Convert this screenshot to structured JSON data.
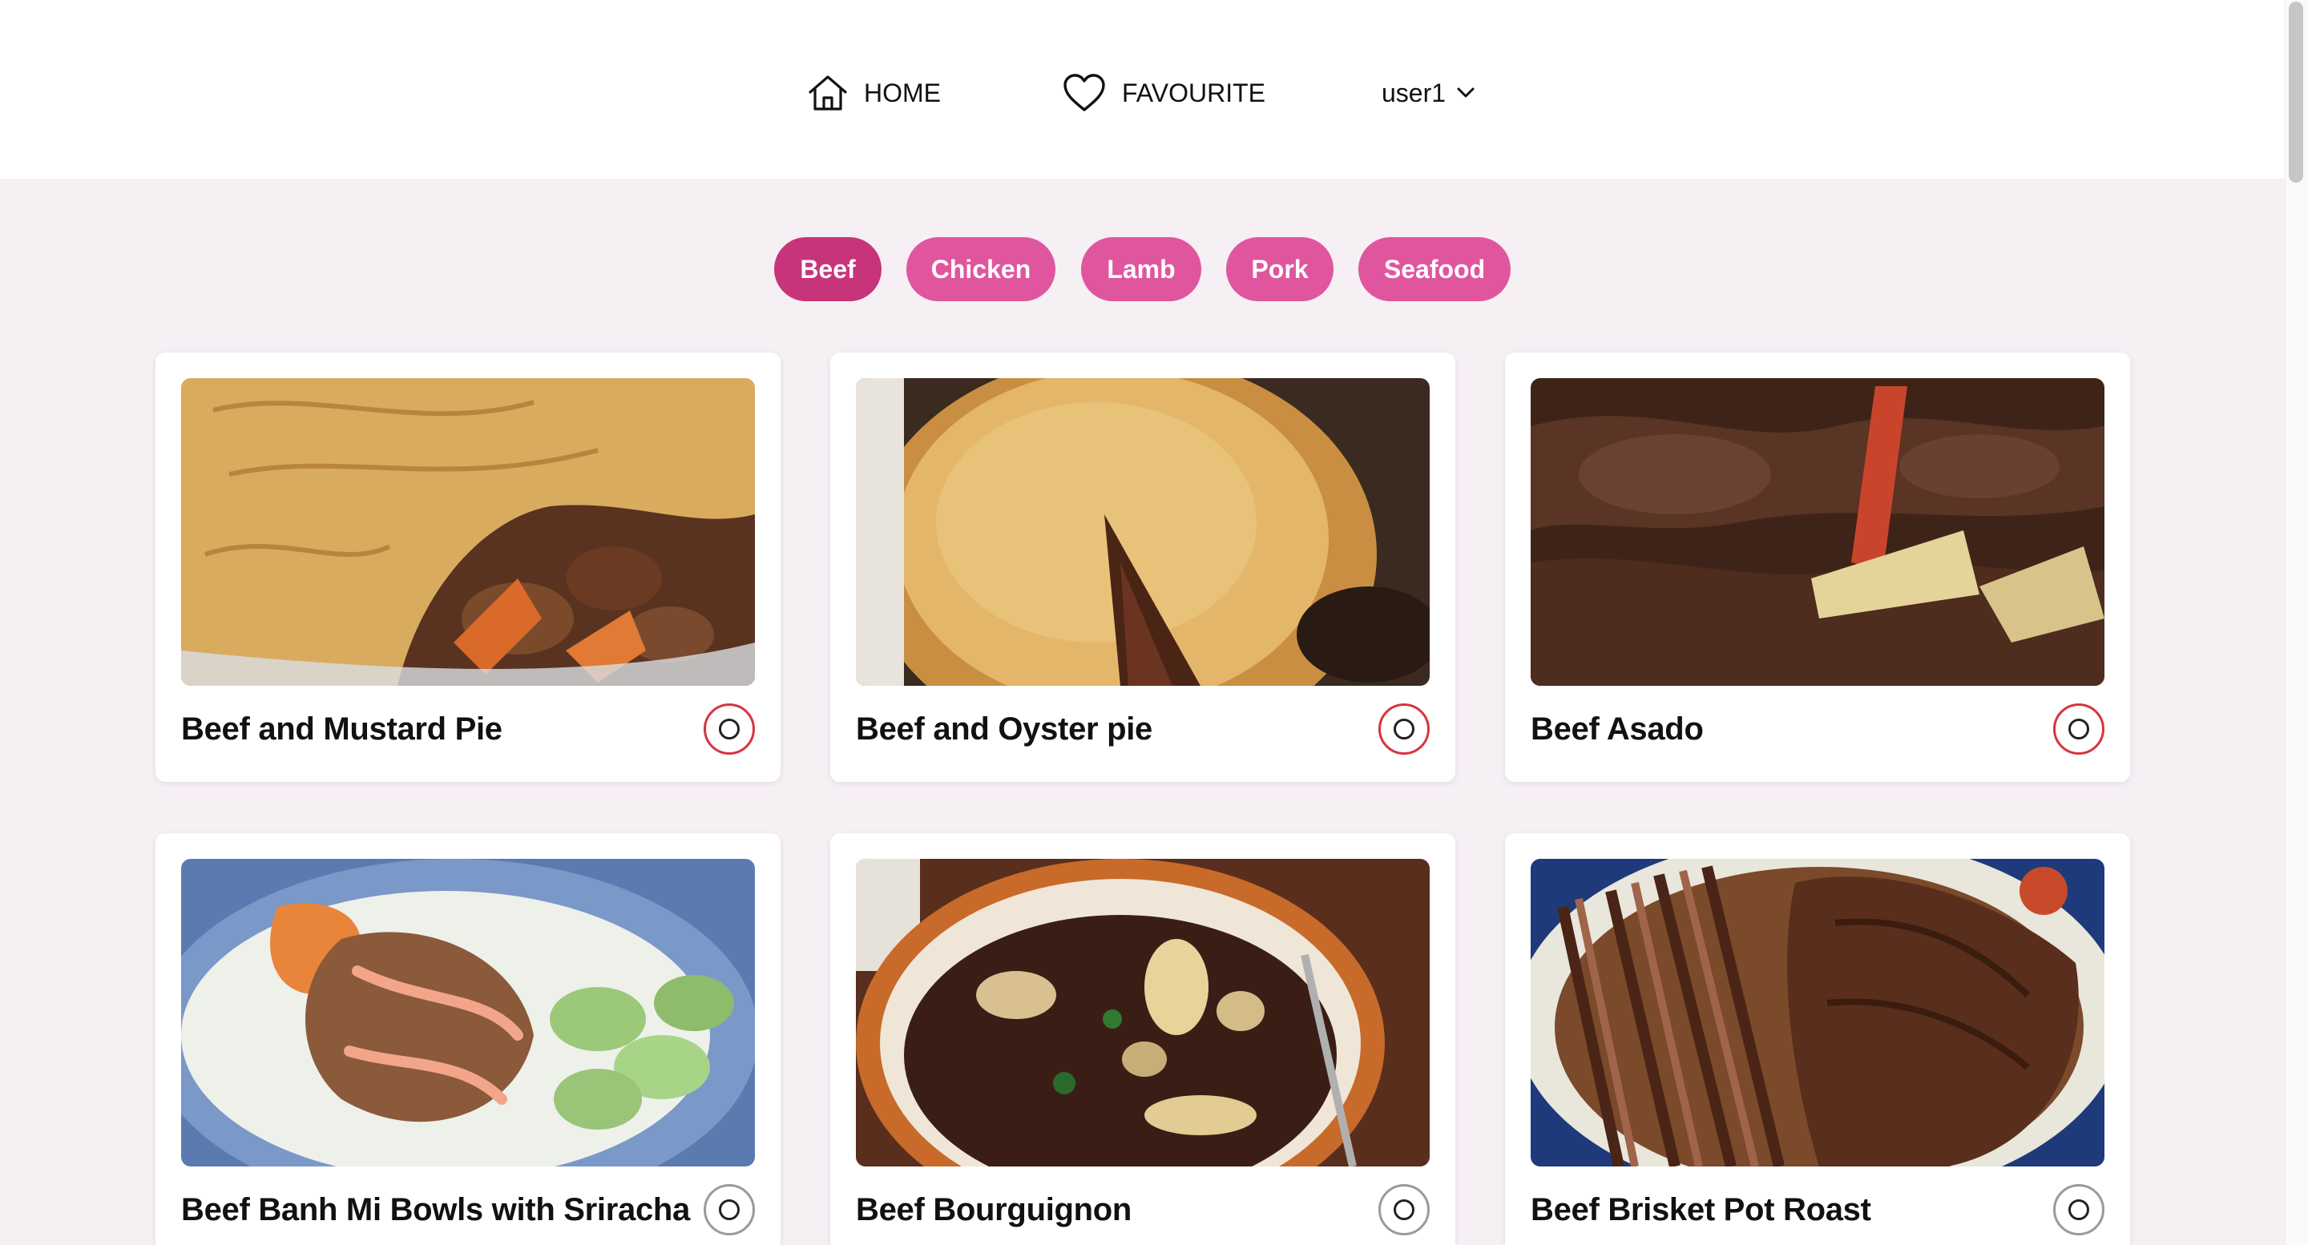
{
  "nav": {
    "home_label": "HOME",
    "favourite_label": "FAVOURITE",
    "user_label": "user1"
  },
  "categories": [
    "Beef",
    "Chicken",
    "Lamb",
    "Pork",
    "Seafood"
  ],
  "active_category": "Beef",
  "recipes": [
    {
      "title": "Beef and Mustard Pie"
    },
    {
      "title": "Beef and Oyster pie"
    },
    {
      "title": "Beef Asado"
    },
    {
      "title": "Beef Banh Mi Bowls with Sriracha"
    },
    {
      "title": "Beef Bourguignon"
    },
    {
      "title": "Beef Brisket Pot Roast"
    }
  ],
  "colors": {
    "accent": "#e0569e",
    "accent_active": "#c83479",
    "page_bg": "#f6eff4",
    "favourite_ring": "#d8333d"
  }
}
